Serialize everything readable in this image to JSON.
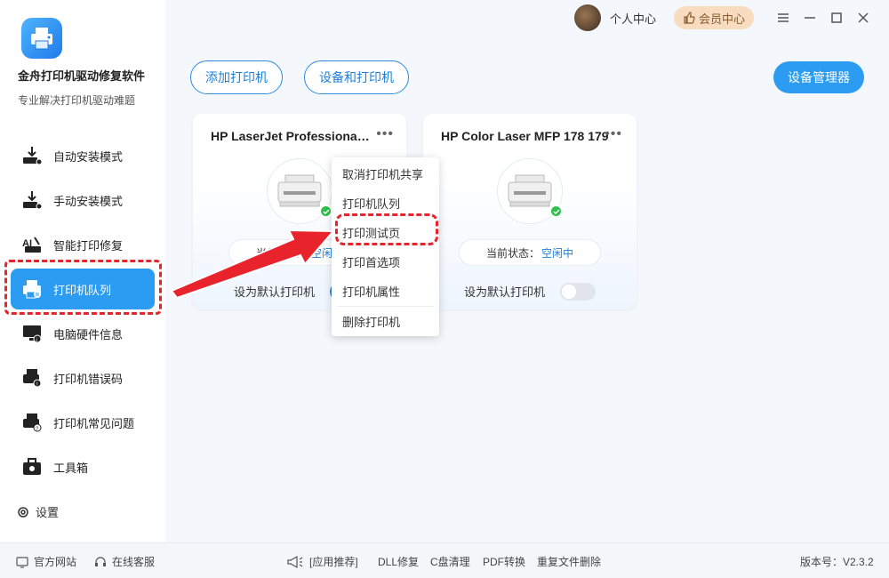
{
  "app": {
    "title": "金舟打印机驱动修复软件",
    "subtitle": "专业解决打印机驱动难题",
    "accent_color": "#2c9cf2"
  },
  "topbar": {
    "personal_center": "个人中心",
    "member_center": "会员中心"
  },
  "sidebar": {
    "items": [
      {
        "label": "自动安装模式",
        "icon": "auto-install-icon"
      },
      {
        "label": "手动安装模式",
        "icon": "manual-install-icon"
      },
      {
        "label": "智能打印修复",
        "icon": "smart-repair-icon"
      },
      {
        "label": "打印机队列",
        "icon": "printer-queue-icon",
        "active": true
      },
      {
        "label": "电脑硬件信息",
        "icon": "hardware-info-icon"
      },
      {
        "label": "打印机错误码",
        "icon": "error-code-icon"
      },
      {
        "label": "打印机常见问题",
        "icon": "faq-icon"
      },
      {
        "label": "工具箱",
        "icon": "toolbox-icon"
      }
    ],
    "settings_label": "设置"
  },
  "toolbar": {
    "add_printer": "添加打印机",
    "devices_printers": "设备和打印机",
    "device_manager": "设备管理器"
  },
  "printers": [
    {
      "name": "HP LaserJet Professional ...",
      "status_label": "当前状态：",
      "status": "空闲中",
      "default_label": "设为默认打印机",
      "is_default": true
    },
    {
      "name": "HP Color Laser MFP 178 179",
      "status_label": "当前状态：",
      "status": "空闲中",
      "default_label": "设为默认打印机",
      "is_default": false
    }
  ],
  "context_menu": {
    "items": [
      "取消打印机共享",
      "打印机队列",
      "打印测试页",
      "打印首选项",
      "打印机属性",
      "删除打印机"
    ]
  },
  "footer": {
    "website": "官方网站",
    "support": "在线客服",
    "recommend": "[应用推荐]",
    "links": [
      "DLL修复",
      "C盘清理",
      "PDF转换",
      "重复文件删除"
    ],
    "version": "版本号：V2.3.2"
  }
}
